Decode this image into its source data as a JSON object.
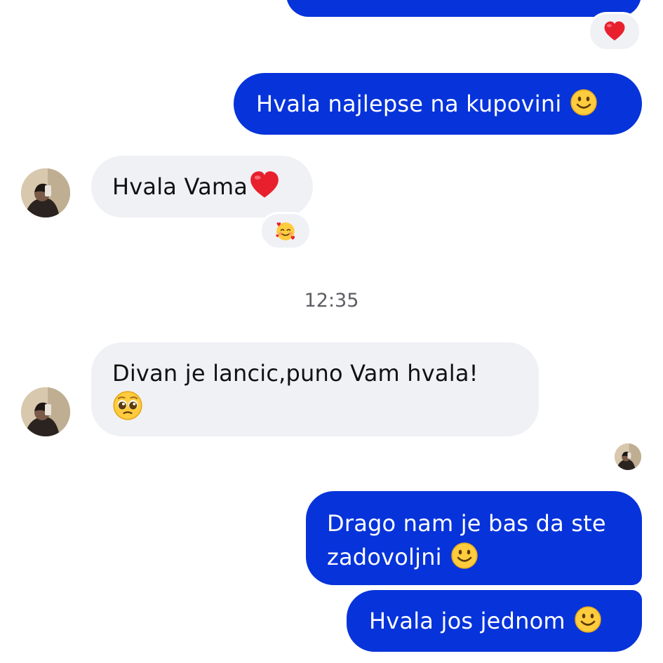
{
  "messages": [
    {
      "text": "Hvala najlepse na kupovini",
      "emoji": "slightly-smiling-face-icon"
    },
    {
      "text": "Hvala Vama",
      "emoji": "red-heart-icon",
      "reaction": "smiling-face-with-hearts-icon"
    },
    {
      "text": "Divan je lancic,puno Vam hvala!",
      "emoji": "pleading-face-icon"
    },
    {
      "line1": "Drago nam je bas da ste",
      "line2": "zadovoljni",
      "emoji": "slightly-smiling-face-icon"
    },
    {
      "text": "Hvala jos jednom",
      "emoji": "slightly-smiling-face-icon"
    }
  ],
  "top_reaction": "red-heart-icon",
  "timestamp": "12:35",
  "colors": {
    "outgoing_bubble": "#0633da",
    "incoming_bubble": "#f0f1f5",
    "timestamp_text": "#5d5d63"
  }
}
